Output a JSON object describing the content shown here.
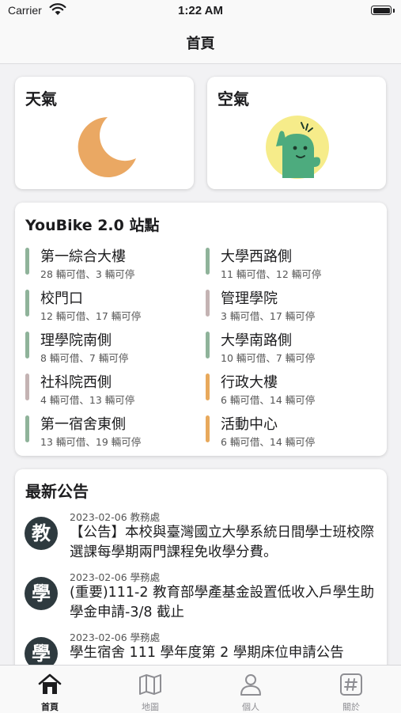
{
  "status_bar": {
    "carrier": "Carrier",
    "time": "1:22 AM"
  },
  "nav": {
    "title": "首頁"
  },
  "weather": {
    "title": "天氣",
    "icon": "moon-icon",
    "color": "#eaa863"
  },
  "air": {
    "title": "空氣",
    "icon": "air-quality-mascot-icon",
    "color": "#f6ec8a"
  },
  "youbike": {
    "title": "YouBike 2.0 站點",
    "stations": [
      {
        "name": "第一綜合大樓",
        "availability": "28 輛可借、3 輛可停",
        "color": "#8fb39a"
      },
      {
        "name": "大學西路側",
        "availability": "11 輛可借、12 輛可停",
        "color": "#8fb39a"
      },
      {
        "name": "校門口",
        "availability": "12 輛可借、17 輛可停",
        "color": "#8fb39a"
      },
      {
        "name": "管理學院",
        "availability": "3 輛可借、17 輛可停",
        "color": "#c4b3b3"
      },
      {
        "name": "理學院南側",
        "availability": "8 輛可借、7 輛可停",
        "color": "#8fb39a"
      },
      {
        "name": "大學南路側",
        "availability": "10 輛可借、7 輛可停",
        "color": "#8fb39a"
      },
      {
        "name": "社科院西側",
        "availability": "4 輛可借、13 輛可停",
        "color": "#c4b3b3"
      },
      {
        "name": "行政大樓",
        "availability": "6 輛可借、14 輛可停",
        "color": "#e8a95c"
      },
      {
        "name": "第一宿舍東側",
        "availability": "13 輛可借、19 輛可停",
        "color": "#8fb39a"
      },
      {
        "name": "活動中心",
        "availability": "6 輛可借、14 輛可停",
        "color": "#e8a95c"
      }
    ]
  },
  "news": {
    "title": "最新公告",
    "items": [
      {
        "badge": "教",
        "date": "2023-02-06",
        "unit": "教務處",
        "text": "【公告】本校與臺灣國立大學系統日間學士班校際選課每學期兩門課程免收學分費。"
      },
      {
        "badge": "學",
        "date": "2023-02-06",
        "unit": "學務處",
        "text": "(重要)111-2 教育部學產基金設置低收入戶學生助學金申請-3/8 截止"
      },
      {
        "badge": "學",
        "date": "2023-02-06",
        "unit": "學務處",
        "text": "學生宿舍 111 學年度第 2 學期床位申請公告"
      }
    ]
  },
  "tabs": [
    {
      "label": "首頁",
      "icon": "home-icon",
      "active": true
    },
    {
      "label": "地圖",
      "icon": "map-icon",
      "active": false
    },
    {
      "label": "個人",
      "icon": "person-icon",
      "active": false
    },
    {
      "label": "關於",
      "icon": "hashtag-icon",
      "active": false
    }
  ]
}
